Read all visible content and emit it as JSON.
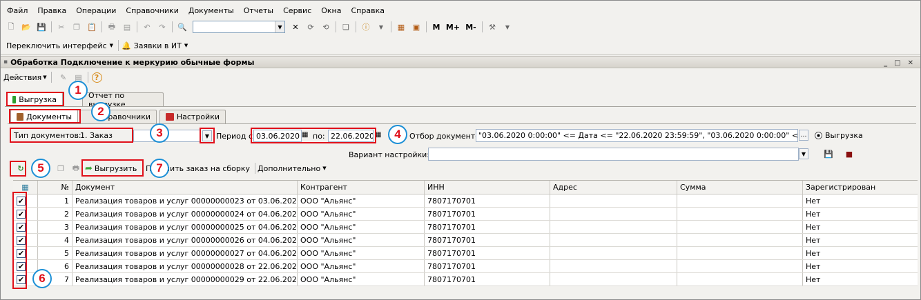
{
  "menu": [
    "Файл",
    "Правка",
    "Операции",
    "Справочники",
    "Документы",
    "Отчеты",
    "Сервис",
    "Окна",
    "Справка"
  ],
  "toolbar": {
    "search_value": "",
    "m_label": "M",
    "mplus_label": "M+",
    "mminus_label": "M-"
  },
  "toolbar2": {
    "switch_interface": "Переключить интерфейс",
    "it_requests": "Заявки в ИТ"
  },
  "window_title": "Обработка  Подключение к меркурию обычные формы",
  "actions_label": "Действия",
  "tabs_main": [
    {
      "label": "Выгрузка"
    },
    {
      "label": "Отчет по выгрузке"
    }
  ],
  "tabs_sub": [
    {
      "label": "Документы"
    },
    {
      "label": "Справочники"
    },
    {
      "label": "Настройки"
    }
  ],
  "filters": {
    "doc_type_label": "Тип документов:",
    "doc_type_value": "1. Заказ",
    "period_label": "Период с:",
    "period_from": "03.06.2020",
    "period_to_label": "по:",
    "period_to": "22.06.2020",
    "selection_label": "Отбор документов:",
    "selection_value": "\"03.06.2020 0:00:00\" <= Дата <= \"22.06.2020 23:59:59\", \"03.06.2020 0:00:00\" <= Дата <= \"22...",
    "radio_label": "Выгрузка",
    "variant_label": "Вариант настройки:",
    "variant_value": ""
  },
  "commands": {
    "upload": "Выгрузить",
    "get_order": "Получить заказ на сборку",
    "more": "Дополнительно"
  },
  "badges": [
    "1",
    "2",
    "3",
    "4",
    "5",
    "6",
    "7"
  ],
  "table": {
    "headers": [
      "№",
      "Документ",
      "Контрагент",
      "ИНН",
      "Адрес",
      "Сумма",
      "Зарегистрирован"
    ],
    "rows": [
      {
        "n": "1",
        "doc": "Реализация товаров и услуг 00000000023 от 03.06.2020 16:...",
        "contractor": "ООО \"Альянс\"",
        "inn": "7807170701",
        "address": "",
        "sum": "",
        "reg": "Нет",
        "checked": "✔"
      },
      {
        "n": "2",
        "doc": "Реализация товаров и услуг 00000000024 от 04.06.2020 13:...",
        "contractor": "ООО \"Альянс\"",
        "inn": "7807170701",
        "address": "",
        "sum": "",
        "reg": "Нет",
        "checked": "✔"
      },
      {
        "n": "3",
        "doc": "Реализация товаров и услуг 00000000025 от 04.06.2020 13:...",
        "contractor": "ООО \"Альянс\"",
        "inn": "7807170701",
        "address": "",
        "sum": "",
        "reg": "Нет",
        "checked": "✔"
      },
      {
        "n": "4",
        "doc": "Реализация товаров и услуг 00000000026 от 04.06.2020 13:...",
        "contractor": "ООО \"Альянс\"",
        "inn": "7807170701",
        "address": "",
        "sum": "",
        "reg": "Нет",
        "checked": "✔"
      },
      {
        "n": "5",
        "doc": "Реализация товаров и услуг 00000000027 от 04.06.2020 13:...",
        "contractor": "ООО \"Альянс\"",
        "inn": "7807170701",
        "address": "",
        "sum": "",
        "reg": "Нет",
        "checked": "✔"
      },
      {
        "n": "6",
        "doc": "Реализация товаров и услуг 00000000028 от 22.06.2020 10:...",
        "contractor": "ООО \"Альянс\"",
        "inn": "7807170701",
        "address": "",
        "sum": "",
        "reg": "Нет",
        "checked": "✔"
      },
      {
        "n": "7",
        "doc": "Реализация товаров и услуг 00000000029 от 22.06.2020 10:...",
        "contractor": "ООО \"Альянс\"",
        "inn": "7807170701",
        "address": "",
        "sum": "",
        "reg": "Нет",
        "checked": "✔"
      }
    ]
  },
  "colors": {
    "highlight": "#e0101a",
    "badge_border": "#1b8fd6",
    "frame": "#f2f1ee"
  }
}
